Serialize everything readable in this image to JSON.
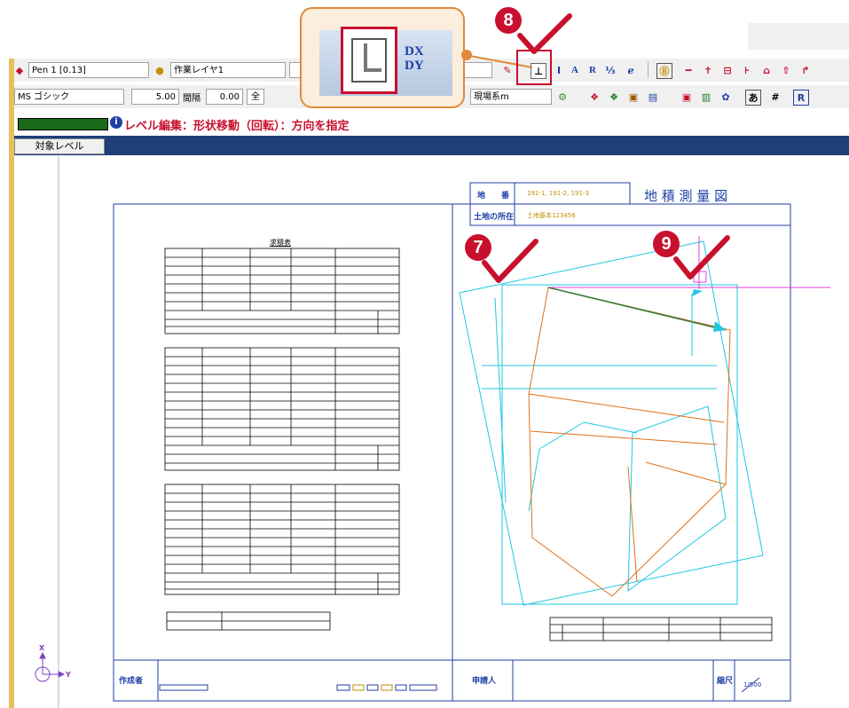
{
  "toolbar1": {
    "pen_label": "Pen 1 [0.13]",
    "layer_label": "作業レイヤ1",
    "symbol_a": "A",
    "symbol_r": "R",
    "symbol_frac": "⅓"
  },
  "toolbar2": {
    "font_name": "MS ゴシック",
    "font_size": "5.00",
    "spacing_label": "間隔",
    "spacing_value": "0.00",
    "all_label": "全",
    "coord_system": "現場系m"
  },
  "zoom_popup": {
    "text1": "DX",
    "text2": "DY"
  },
  "status": {
    "mode_text": "レベル編集：形状移動（回転）：方向を指定"
  },
  "tabbar": {
    "target_level": "対象レベル"
  },
  "markers": {
    "m7": "7",
    "m8": "8",
    "m9": "9"
  },
  "drawing": {
    "title": "地 積 測 量 図",
    "lot_label": "地　　番",
    "lot_value": "191-1, 191-2, 191-3",
    "location_label": "土地の所在",
    "location_value": "土地基本123456",
    "table_title": "求積表",
    "creator_label": "作成者",
    "applicant_label": "申請人",
    "scale_label": "縮尺",
    "scale_value": "1/500",
    "axis_x": "X",
    "axis_y": "Y"
  }
}
